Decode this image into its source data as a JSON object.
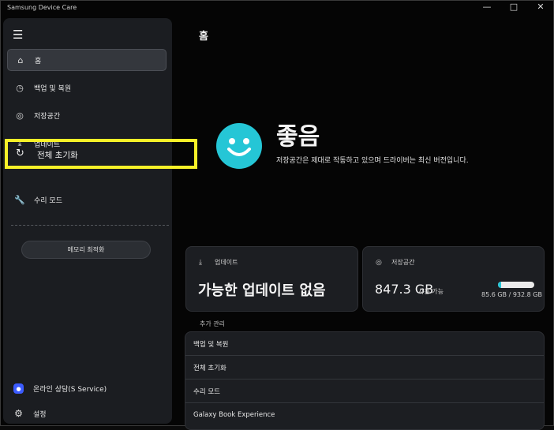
{
  "window": {
    "title": "Samsung Device Care",
    "controls": {
      "minimize": "—",
      "maximize": "□",
      "close": "✕"
    }
  },
  "sidebar": {
    "menu_icon": "☰",
    "items": [
      {
        "icon": "home-icon",
        "glyph": "⌂",
        "label": "홈"
      },
      {
        "icon": "backup-icon",
        "glyph": "◷",
        "label": "백업 및 복원"
      },
      {
        "icon": "storage-icon",
        "glyph": "◎",
        "label": "저장공간"
      },
      {
        "icon": "download-icon",
        "glyph": "⤓",
        "label": "업데이트"
      },
      {
        "icon": "reset-icon",
        "glyph": "↻",
        "label": "전체 초기화"
      },
      {
        "icon": "wrench-icon",
        "glyph": "🔧",
        "label": "수리 모드"
      }
    ],
    "memory_button": "메모리 최적화",
    "bottom": [
      {
        "icon": "chat-icon",
        "glyph": "●",
        "label": "온라인 상담(S Service)"
      },
      {
        "icon": "gear-icon",
        "glyph": "⚙",
        "label": "설정"
      }
    ]
  },
  "main": {
    "page_title": "홈",
    "status": {
      "title": "좋음",
      "description": "저장공간은 제대로 작동하고 있으며 드라이버는 최신 버전입니다."
    },
    "update_card": {
      "icon": "⤓",
      "label": "업데이트",
      "value": "가능한 업데이트 없음"
    },
    "storage_card": {
      "icon": "◎",
      "label": "저장공간",
      "value": "847.3 GB",
      "unit": "사용 가능",
      "detail": "85.6 GB / 932.8 GB",
      "used_fraction": 0.092
    },
    "extra": {
      "title": "추가 관리",
      "items": [
        "백업 및 복원",
        "전체 초기화",
        "수리 모드",
        "Galaxy Book Experience"
      ]
    }
  },
  "colors": {
    "accent": "#25c6d6",
    "highlight": "#f7f028",
    "panel": "#1b1d21"
  }
}
